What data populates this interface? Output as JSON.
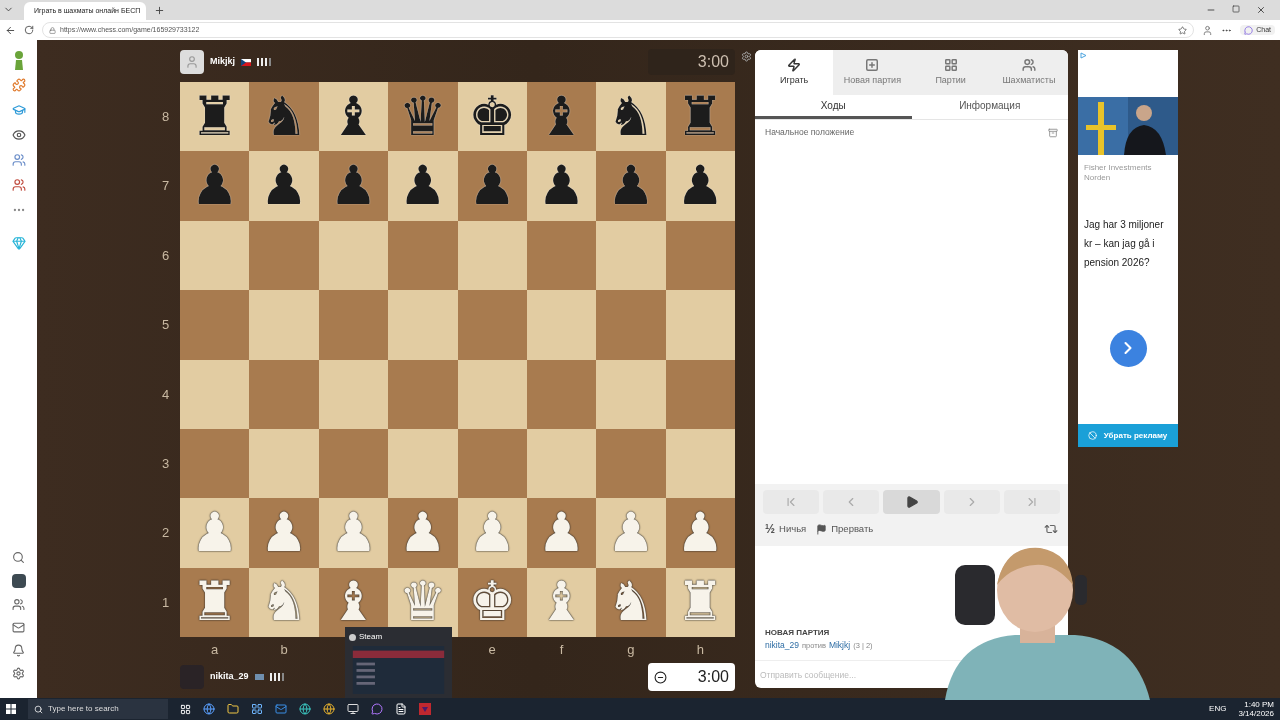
{
  "browser": {
    "tab_title": "Играть в шахматы онлайн БЕСП",
    "url": "https://www.chess.com/game/165929733122",
    "chat_button": "Chat"
  },
  "top_player": {
    "name": "Mikjkj",
    "clock": "3:00"
  },
  "board": {
    "ranks": [
      {
        "label": "8",
        "pieces": [
          {
            "glyph": "♜",
            "kind": "black"
          },
          {
            "glyph": "♞",
            "kind": "black"
          },
          {
            "glyph": "♝",
            "kind": "black"
          },
          {
            "glyph": "♛",
            "kind": "black"
          },
          {
            "glyph": "♚",
            "kind": "black"
          },
          {
            "glyph": "♝",
            "kind": "black"
          },
          {
            "glyph": "♞",
            "kind": "black"
          },
          {
            "glyph": "♜",
            "kind": "black"
          }
        ]
      },
      {
        "label": "7",
        "pieces": [
          {
            "glyph": "♟",
            "kind": "black"
          },
          {
            "glyph": "♟",
            "kind": "black"
          },
          {
            "glyph": "♟",
            "kind": "black"
          },
          {
            "glyph": "♟",
            "kind": "black"
          },
          {
            "glyph": "♟",
            "kind": "black"
          },
          {
            "glyph": "♟",
            "kind": "black"
          },
          {
            "glyph": "♟",
            "kind": "black"
          },
          {
            "glyph": "♟",
            "kind": "black"
          }
        ]
      },
      {
        "label": "6"
      },
      {
        "label": "5"
      },
      {
        "label": "4"
      },
      {
        "label": "3"
      },
      {
        "label": "2",
        "pieces": [
          {
            "glyph": "♟",
            "kind": "white"
          },
          {
            "glyph": "♟",
            "kind": "white"
          },
          {
            "glyph": "♟",
            "kind": "white"
          },
          {
            "glyph": "♟",
            "kind": "white"
          },
          {
            "glyph": "♟",
            "kind": "white"
          },
          {
            "glyph": "♟",
            "kind": "white"
          },
          {
            "glyph": "♟",
            "kind": "white"
          },
          {
            "glyph": "♟",
            "kind": "white"
          }
        ]
      },
      {
        "label": "1",
        "pieces": [
          {
            "glyph": "♜",
            "kind": "white"
          },
          {
            "glyph": "♞",
            "kind": "white"
          },
          {
            "glyph": "♝",
            "kind": "white"
          },
          {
            "glyph": "♛",
            "kind": "white"
          },
          {
            "glyph": "♚",
            "kind": "white"
          },
          {
            "glyph": "♝",
            "kind": "white"
          },
          {
            "glyph": "♞",
            "kind": "white"
          },
          {
            "glyph": "♜",
            "kind": "white"
          }
        ]
      }
    ],
    "files": [
      {
        "label": "a"
      },
      {
        "label": "b"
      },
      {
        "covered": true
      },
      {
        "covered": true
      },
      {
        "label": "e"
      },
      {
        "label": "f"
      },
      {
        "label": "g"
      },
      {
        "label": "h"
      }
    ]
  },
  "bottom_player": {
    "name": "nikita_29",
    "clock": "3:00"
  },
  "panel": {
    "tabs": [
      {
        "kind": "play",
        "label": "Играть",
        "selected": true
      },
      {
        "kind": "new",
        "label": "Новая партия",
        "selected": false
      },
      {
        "kind": "games",
        "label": "Партии",
        "selected": false
      },
      {
        "kind": "players",
        "label": "Шахматисты",
        "selected": false
      }
    ],
    "subtabs": [
      {
        "label": "Ходы",
        "selected": true
      },
      {
        "label": "Информация",
        "selected": false
      }
    ],
    "start_position": "Начальное положение",
    "nav_buttons": [
      {
        "kind": "first",
        "selected": false
      },
      {
        "kind": "prev",
        "selected": false
      },
      {
        "kind": "play",
        "selected": true
      },
      {
        "kind": "next",
        "selected": false
      },
      {
        "kind": "last",
        "selected": false
      }
    ],
    "actions": [
      {
        "kind": "draw",
        "icon": "½",
        "label": "Ничья"
      },
      {
        "kind": "abort",
        "label": "Прервать"
      }
    ],
    "chat": {
      "heading": "НОВАЯ ПАРТИЯ",
      "white": "nikita_29",
      "versus": "против",
      "black": "Mikjkj",
      "time_control": "(3 | 2)",
      "placeholder": "Отправить сообщение..."
    }
  },
  "ad": {
    "advertiser": "Fisher Investments Norden",
    "headline": "Jag har 3 miljoner kr – kan jag gå i pension 2026?",
    "remove_button": "Убрать рекламу"
  },
  "steam_preview": {
    "title": "Steam"
  },
  "taskbar": {
    "search_placeholder": "Type here to search",
    "language": "ENG",
    "time": "1:40 PM",
    "date": "3/14/2026"
  }
}
